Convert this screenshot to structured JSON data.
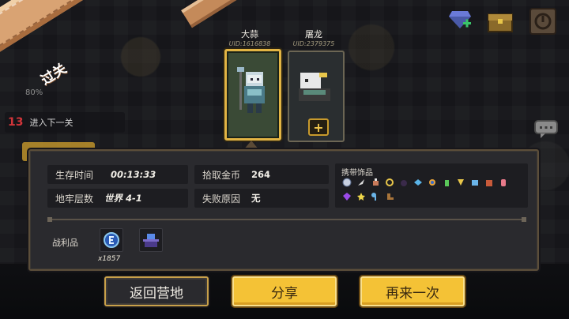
{
  "banner": {
    "title": "过关"
  },
  "hud": {
    "percent": "80%",
    "level_number": "13",
    "level_text": "进入下一关"
  },
  "characters": [
    {
      "name": "大蒜",
      "uid": "UID:1616838",
      "selected": true
    },
    {
      "name": "屠龙",
      "uid": "UID:2379375",
      "selected": false
    }
  ],
  "add_slot": {
    "label": "+"
  },
  "stats": {
    "survival_time_label": "生存时间",
    "survival_time_value": "00:13:33",
    "gold_label": "拾取金币",
    "gold_value": "264",
    "floor_label": "地牢层数",
    "floor_value": "世界 4-1",
    "fail_reason_label": "失败原因",
    "fail_reason_value": "无"
  },
  "accessories": {
    "title": "携带饰品",
    "row1_icons": [
      "round-shield-icon",
      "feather-icon",
      "potion-icon",
      "ring-icon",
      "dark-orb-icon",
      "blue-bird-icon",
      "blue-medal-icon",
      "green-bottle-icon",
      "gold-wing-icon",
      "blue-helmet-icon",
      "red-pot-icon",
      "pink-tooth-icon"
    ],
    "row2_icons": [
      "purple-gem-icon",
      "star-icon",
      "blue-key-icon",
      "brown-boot-icon"
    ]
  },
  "loot": {
    "label": "战利品",
    "items": [
      {
        "icon": "blue-coin-icon",
        "count": "x1857"
      },
      {
        "icon": "purple-pedestal-icon",
        "count": ""
      }
    ]
  },
  "buttons": {
    "return_camp": "返回营地",
    "share": "分享",
    "play_again": "再来一次"
  },
  "colors": {
    "gold_button": "#f4c236",
    "banner": "#d9a373",
    "panel": "#2a2a2e",
    "level_red": "#d2353a"
  }
}
